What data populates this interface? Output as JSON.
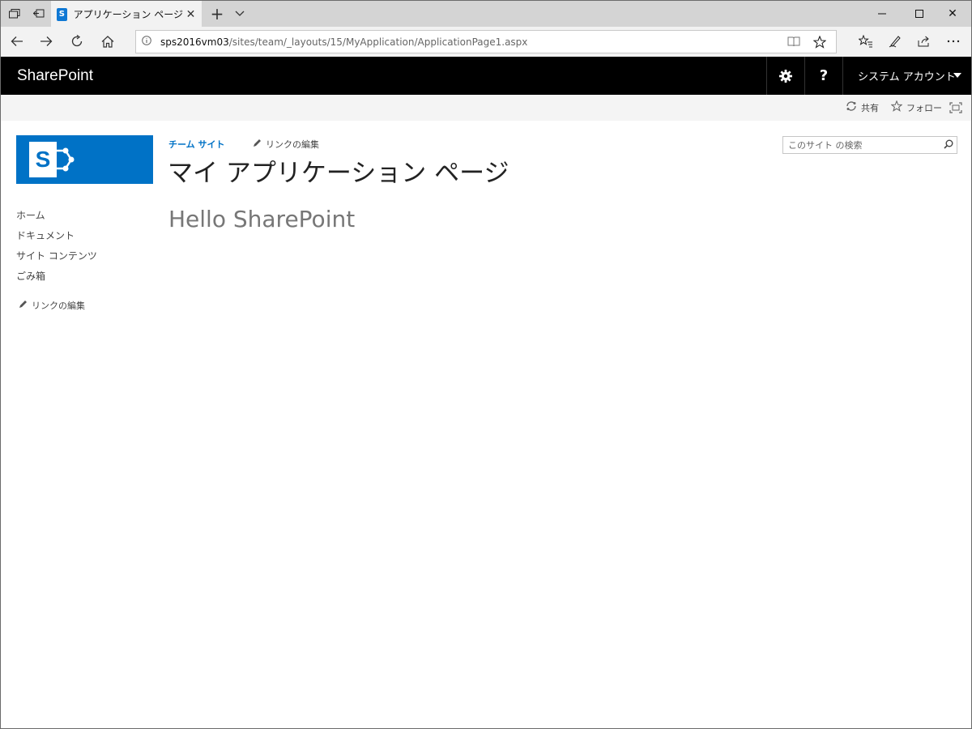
{
  "browser": {
    "tab_title": "アプリケーション ページ",
    "tab_favicon_letter": "S",
    "address_host": "sps2016vm03",
    "address_path": "/sites/team/_layouts/15/MyApplication/ApplicationPage1.aspx"
  },
  "suite_bar": {
    "brand": "SharePoint",
    "user_name": "システム アカウント",
    "help_label": "?"
  },
  "ribbon": {
    "share_label": "共有",
    "follow_label": "フォロー"
  },
  "site": {
    "logo_letter": "S",
    "breadcrumb": "チーム サイト",
    "edit_links_top": "リンクの編集",
    "page_title": "マイ アプリケーション ページ",
    "search_placeholder": "このサイト の検索",
    "quick_launch": [
      {
        "label": "ホーム"
      },
      {
        "label": "ドキュメント"
      },
      {
        "label": "サイト コンテンツ"
      },
      {
        "label": "ごみ箱"
      }
    ],
    "edit_links_left": "リンクの編集",
    "content_text": "Hello SharePoint"
  },
  "colors": {
    "suite_bar_bg": "#000000",
    "accent_blue": "#0072c6",
    "ribbon_bg": "#f4f4f4"
  },
  "icons": [
    "tab-preview-icon",
    "set-aside-icon",
    "sharepoint-favicon",
    "close-icon",
    "plus-icon",
    "chevron-down-icon",
    "minimize-icon",
    "maximize-icon",
    "back-arrow-icon",
    "forward-arrow-icon",
    "refresh-icon",
    "home-icon",
    "info-icon",
    "reading-view-icon",
    "star-icon",
    "favorites-icon",
    "pen-icon",
    "share-icon",
    "more-icon",
    "gear-icon",
    "help-icon",
    "sync-icon",
    "focus-icon",
    "pencil-icon",
    "search-icon"
  ]
}
